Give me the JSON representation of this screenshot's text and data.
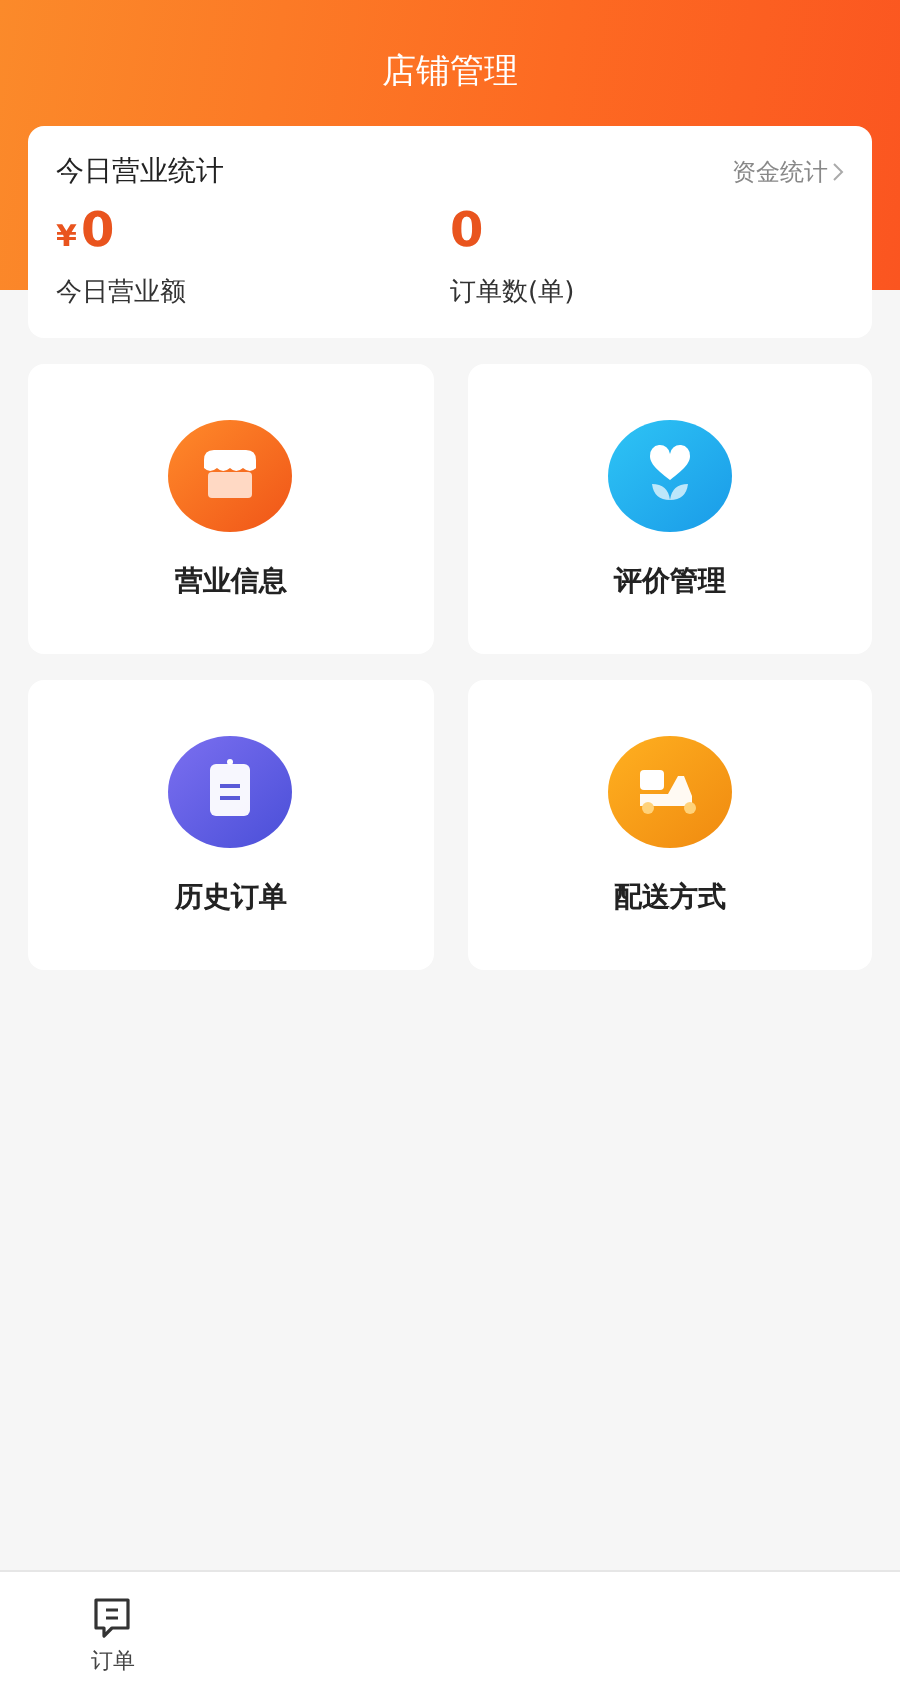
{
  "header": {
    "title": "店铺管理"
  },
  "stats": {
    "title": "今日营业统计",
    "link": "资金统计",
    "metrics": [
      {
        "currency": "¥",
        "value": "0",
        "label": "今日营业额"
      },
      {
        "value": "0",
        "label": "订单数(单)"
      }
    ]
  },
  "tiles": [
    {
      "kind": "shop",
      "label": "营业信息"
    },
    {
      "kind": "review",
      "label": "评价管理"
    },
    {
      "kind": "history",
      "label": "历史订单"
    },
    {
      "kind": "delivery",
      "label": "配送方式"
    }
  ],
  "tabbar": [
    {
      "label": "订单"
    }
  ]
}
